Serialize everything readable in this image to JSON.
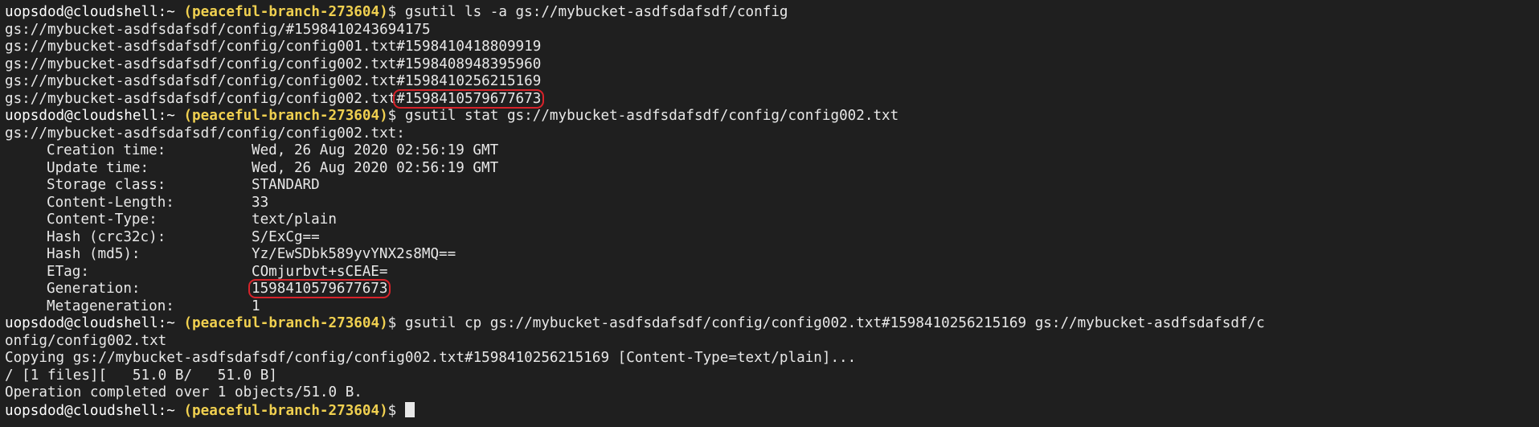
{
  "terminal": {
    "prompt_user": "uopsdod@cloudshell:~",
    "prompt_project": "(peaceful-branch-273604)",
    "prompt_suffix": "$ ",
    "cmd1": "gsutil ls -a gs://mybucket-asdfsdafsdf/config",
    "ls_output": [
      "gs://mybucket-asdfsdafsdf/config/#1598410243694175",
      "gs://mybucket-asdfsdafsdf/config/config001.txt#1598410418809919",
      "gs://mybucket-asdfsdafsdf/config/config002.txt#1598408948395960",
      "gs://mybucket-asdfsdafsdf/config/config002.txt#1598410256215169"
    ],
    "ls_last_path": "gs://mybucket-asdfsdafsdf/config/config002.txt",
    "ls_last_generation": "#1598410579677673",
    "cmd2": "gsutil stat gs://mybucket-asdfsdafsdf/config/config002.txt",
    "stat_header": "gs://mybucket-asdfsdafsdf/config/config002.txt:",
    "stat": {
      "creation_label": "Creation time:",
      "creation_value": "Wed, 26 Aug 2020 02:56:19 GMT",
      "update_label": "Update time:",
      "update_value": "Wed, 26 Aug 2020 02:56:19 GMT",
      "storage_label": "Storage class:",
      "storage_value": "STANDARD",
      "length_label": "Content-Length:",
      "length_value": "33",
      "type_label": "Content-Type:",
      "type_value": "text/plain",
      "crc_label": "Hash (crc32c):",
      "crc_value": "S/ExCg==",
      "md5_label": "Hash (md5):",
      "md5_value": "Yz/EwSDbk589yvYNX2s8MQ==",
      "etag_label": "ETag:",
      "etag_value": "COmjurbvt+sCEAE=",
      "generation_label": "Generation:",
      "generation_value": "1598410579677673",
      "metagen_label": "Metageneration:",
      "metagen_value": "1"
    },
    "cmd3_line1": "gsutil cp gs://mybucket-asdfsdafsdf/config/config002.txt#1598410256215169 gs://mybucket-asdfsdafsdf/c",
    "cmd3_line2": "onfig/config002.txt",
    "copying_line": "Copying gs://mybucket-asdfsdafsdf/config/config002.txt#1598410256215169 [Content-Type=text/plain]...",
    "progress_line": "/ [1 files][   51.0 B/   51.0 B]",
    "completed_line": "Operation completed over 1 objects/51.0 B.",
    "colors": {
      "background": "#1f1f1f",
      "text": "#e8e8e8",
      "project": "#f0d050",
      "highlight": "#d8232a"
    }
  }
}
